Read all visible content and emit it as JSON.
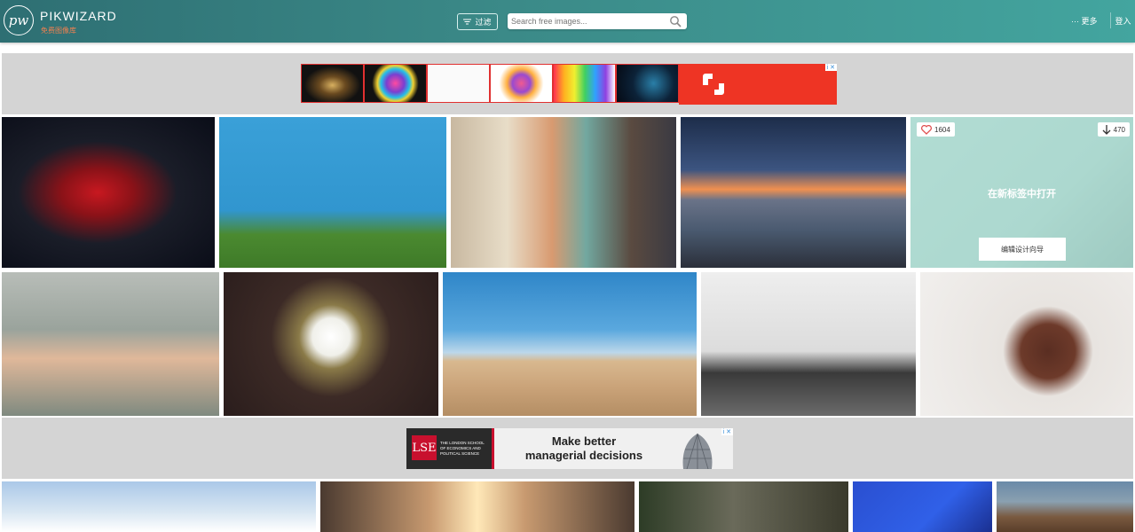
{
  "header": {
    "logo_mark": "pw",
    "logo_name": "PIKWIZARD",
    "logo_tagline": "免费图像库",
    "filter_label": "过滤",
    "search_placeholder": "Search free images...",
    "more_label": "··· 更多",
    "login_label": "登入"
  },
  "ad_top": {
    "close_label": "i ✕"
  },
  "ad_bottom": {
    "lse_mark": "LSE",
    "lse_text": "THE LONDON SCHOOL OF ECONOMICS AND POLITICAL SCIENCE",
    "headline_line1": "Make better",
    "headline_line2": "managerial decisions",
    "close_label": "i ✕"
  },
  "hover_tile": {
    "likes": "1604",
    "downloads": "470",
    "open_in_tab": "在新标签中打开",
    "edit_label": "编辑设计向导"
  },
  "colors": {
    "header_start": "#2e6f73",
    "header_end": "#43a59f",
    "ad_band": "#d4d4d4",
    "accent_orange": "#f08050",
    "shutter_red": "#ee3424",
    "heart_red": "#e05050"
  }
}
